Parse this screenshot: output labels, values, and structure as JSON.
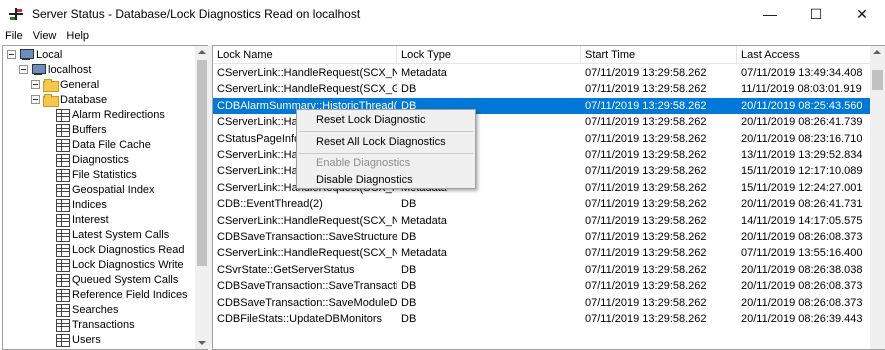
{
  "window": {
    "title": "Server Status - Database/Lock Diagnostics Read on localhost",
    "controls": {
      "minimize": "—",
      "maximize": "☐",
      "close": "✕"
    }
  },
  "menu": [
    "File",
    "View",
    "Help"
  ],
  "tree": {
    "root": "Local",
    "server": "localhost",
    "folders": [
      "General",
      "Database"
    ],
    "items": [
      "Alarm Redirections",
      "Buffers",
      "Data File Cache",
      "Diagnostics",
      "File Statistics",
      "Geospatial Index",
      "Indices",
      "Interest",
      "Latest System Calls",
      "Lock Diagnostics Read",
      "Lock Diagnostics Write",
      "Queued System Calls",
      "Reference Field Indices",
      "Searches",
      "Transactions",
      "Users"
    ]
  },
  "grid": {
    "columns": [
      "Lock Name",
      "Lock Type",
      "Start Time",
      "Last Access"
    ],
    "rows": [
      [
        "CServerLink::HandleRequest(SCX_NET...",
        "Metadata",
        "07/11/2019 13:29:58.262",
        "07/11/2019 13:49:34.408"
      ],
      [
        "CServerLink::HandleRequest(SCX_GET...",
        "DB",
        "07/11/2019 13:29:58.262",
        "11/11/2019 08:03:01.919"
      ],
      [
        "CDBAlarmSummary::HistoricThread(C...",
        "DB",
        "07/11/2019 13:29:58.262",
        "20/11/2019 08:25:43.560"
      ],
      [
        "CServerLink::Han",
        "",
        "07/11/2019 13:29:58.262",
        "20/11/2019 08:26:41.739"
      ],
      [
        "CStatusPageInfo",
        "",
        "07/11/2019 13:29:58.262",
        "20/11/2019 08:23:16.710"
      ],
      [
        "CServerLink::Han",
        "",
        "07/11/2019 13:29:58.262",
        "13/11/2019 13:29:52.834"
      ],
      [
        "CServerLink::Han",
        "",
        "07/11/2019 13:29:58.262",
        "15/11/2019 12:17:10.089"
      ],
      [
        "CServerLink::HandleRequest(SCX_NET...",
        "Metadata",
        "07/11/2019 13:29:58.262",
        "15/11/2019 12:24:27.001"
      ],
      [
        "CDB::EventThread(2)",
        "DB",
        "07/11/2019 13:29:58.262",
        "20/11/2019 08:26:41.731"
      ],
      [
        "CServerLink::HandleRequest(SCX_NET...",
        "Metadata",
        "07/11/2019 13:29:58.262",
        "14/11/2019 14:17:05.575"
      ],
      [
        "CDBSaveTransaction::SaveStructure",
        "DB",
        "07/11/2019 13:29:58.262",
        "20/11/2019 08:26:08.373"
      ],
      [
        "CServerLink::HandleRequest(SCX_NET...",
        "Metadata",
        "07/11/2019 13:29:58.262",
        "07/11/2019 13:55:16.400"
      ],
      [
        "CSvrState::GetServerStatus",
        "DB",
        "07/11/2019 13:29:58.262",
        "20/11/2019 08:26:38.038"
      ],
      [
        "CDBSaveTransaction::SaveTransactions",
        "DB",
        "07/11/2019 13:29:58.262",
        "20/11/2019 08:26:08.373"
      ],
      [
        "CDBSaveTransaction::SaveModuleData",
        "DB",
        "07/11/2019 13:29:58.262",
        "20/11/2019 08:26:08.373"
      ],
      [
        "CDBFileStats::UpdateDBMonitors",
        "DB",
        "07/11/2019 13:29:58.262",
        "20/11/2019 08:26:39.443"
      ]
    ]
  },
  "context_menu": {
    "items": [
      "Reset Lock Diagnostic",
      "Reset All Lock Diagnostics",
      "Enable Diagnostics",
      "Disable Diagnostics"
    ]
  },
  "colors": {
    "selection": "#0078d7",
    "folder": "#f5c84c"
  }
}
